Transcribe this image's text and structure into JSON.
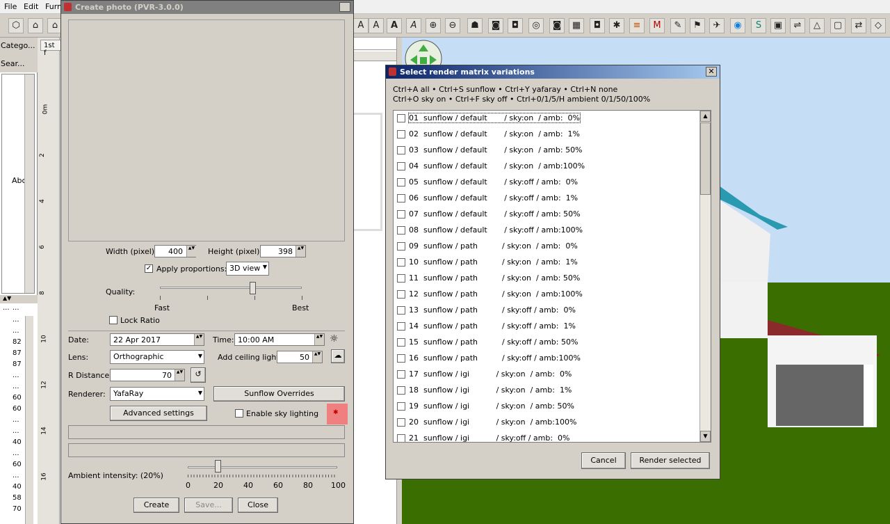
{
  "menubar": {
    "file": "File",
    "edit": "Edit",
    "furn": "Furn"
  },
  "leftpanel": {
    "category": "Catego...",
    "search": "Sear...",
    "item": "Abc",
    "col1": "...",
    "col2": "...",
    "rows": [
      "...",
      "...",
      "82",
      "87",
      "87",
      "...",
      "...",
      "60",
      "60",
      "...",
      "...",
      "40",
      "...",
      "60",
      "...",
      "40",
      "58",
      "70"
    ]
  },
  "plan": {
    "tab": "1st f"
  },
  "ruler": {
    "labels": [
      "0m",
      "2",
      "4",
      "6",
      "8",
      "10",
      "12",
      "14",
      "16"
    ]
  },
  "photo": {
    "title": "Create photo (PVR-3.0.0)",
    "width_label": "Width (pixel):",
    "width": "400",
    "height_label": "Height (pixel):",
    "height": "398",
    "apply_prop": "Apply proportions:",
    "view": "3D view",
    "quality": "Quality:",
    "fast": "Fast",
    "best": "Best",
    "quality_level": 0.65,
    "lock_ratio": "Lock Ratio",
    "date_label": "Date:",
    "date": "22 Apr 2017",
    "time_label": "Time:",
    "time": "10:00 AM",
    "lens_label": "Lens:",
    "lens": "Orthographic",
    "ceiling_label": "Add ceiling lights",
    "ceiling": "50",
    "rdist_label": "R Distance:",
    "rdist": "70",
    "renderer_label": "Renderer:",
    "renderer": "YafaRay",
    "sunflow_overrides": "Sunflow Overrides",
    "advanced": "Advanced settings",
    "sky_lighting": "Enable sky lighting",
    "ambient_label": "Ambient intensity: (20%)",
    "ambient_value": 20,
    "ticks": [
      "0",
      "20",
      "40",
      "60",
      "80",
      "100"
    ],
    "create": "Create",
    "save": "Save...",
    "close": "Close"
  },
  "matrix": {
    "title": "Select render matrix variations",
    "help1": "Ctrl+A all • Ctrl+S sunflow • Ctrl+Y yafaray • Ctrl+N none",
    "help2": "Ctrl+O sky on • Ctrl+F sky off • Ctrl+0/1/5/H ambient 0/1/50/100%",
    "items": [
      "01  sunflow / default       / sky:on  / amb:  0%",
      "02  sunflow / default       / sky:on  / amb:  1%",
      "03  sunflow / default       / sky:on  / amb: 50%",
      "04  sunflow / default       / sky:on  / amb:100%",
      "05  sunflow / default       / sky:off / amb:  0%",
      "06  sunflow / default       / sky:off / amb:  1%",
      "07  sunflow / default       / sky:off / amb: 50%",
      "08  sunflow / default       / sky:off / amb:100%",
      "09  sunflow / path          / sky:on  / amb:  0%",
      "10  sunflow / path          / sky:on  / amb:  1%",
      "11  sunflow / path          / sky:on  / amb: 50%",
      "12  sunflow / path          / sky:on  / amb:100%",
      "13  sunflow / path          / sky:off / amb:  0%",
      "14  sunflow / path          / sky:off / amb:  1%",
      "15  sunflow / path          / sky:off / amb: 50%",
      "16  sunflow / path          / sky:off / amb:100%",
      "17  sunflow / igi           / sky:on  / amb:  0%",
      "18  sunflow / igi           / sky:on  / amb:  1%",
      "19  sunflow / igi           / sky:on  / amb: 50%",
      "20  sunflow / igi           / sky:on  / amb:100%",
      "21  sunflow / igi           / sky:off / amb:  0%"
    ],
    "cancel": "Cancel",
    "render": "Render selected"
  },
  "colors": {
    "titlebar_active": "#0a246a",
    "titlebar_inactive": "#808080",
    "highlight": "#f08080"
  }
}
